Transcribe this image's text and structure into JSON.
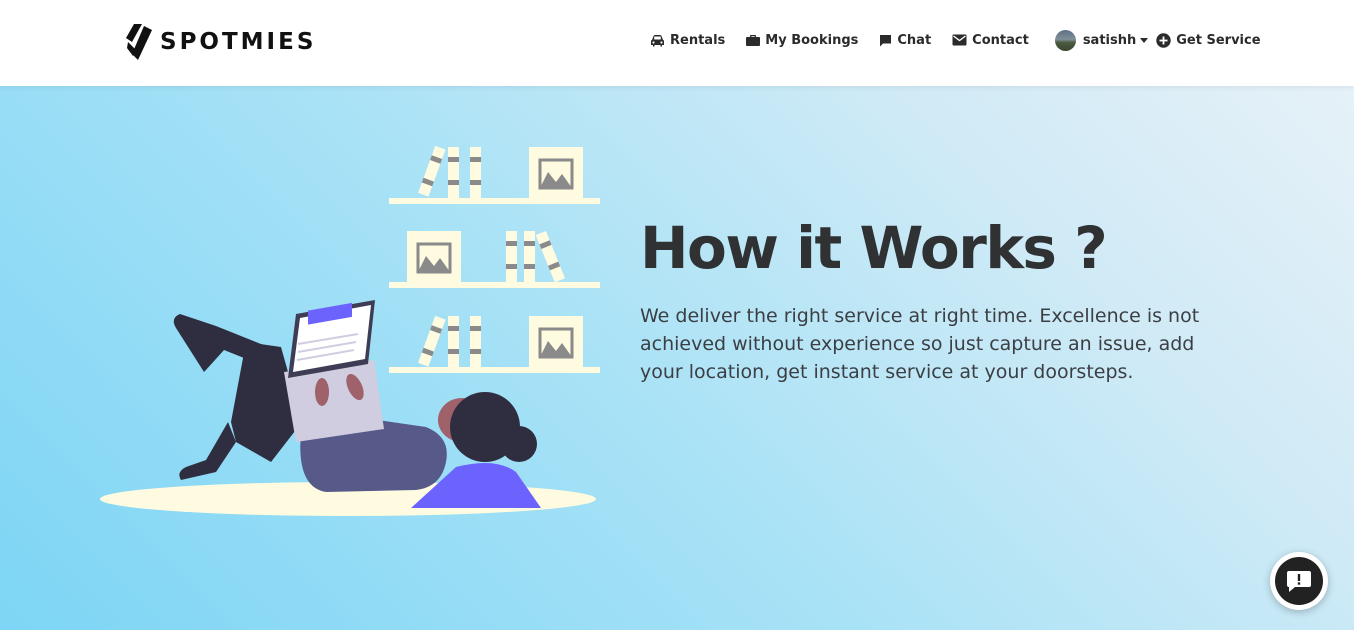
{
  "brand": {
    "name": "SPOTMIES",
    "logo_icon": "spotmies-logo-mark"
  },
  "nav": {
    "rentals": {
      "label": "Rentals",
      "icon": "car-icon"
    },
    "bookings": {
      "label": "My Bookings",
      "icon": "briefcase-icon"
    },
    "chat": {
      "label": "Chat",
      "icon": "chat-icon"
    },
    "contact": {
      "label": "Contact",
      "icon": "envelope-icon"
    },
    "user": {
      "name": "satishh",
      "icon": "avatar"
    },
    "get_service": {
      "label": "Get Service",
      "icon": "plus-circle-icon"
    }
  },
  "hero": {
    "title": "How it Works ?",
    "description": "We deliver the right service at right time. Excellence is not achieved without experience so just capture an issue, add your location, get instant service at your doorsteps."
  },
  "help_button": {
    "icon": "feedback-icon"
  },
  "colors": {
    "hero_gradient_start": "#7dd5f5",
    "hero_gradient_end": "#e6f1f8",
    "title": "#2f3133",
    "accent": "#6c63ff"
  }
}
